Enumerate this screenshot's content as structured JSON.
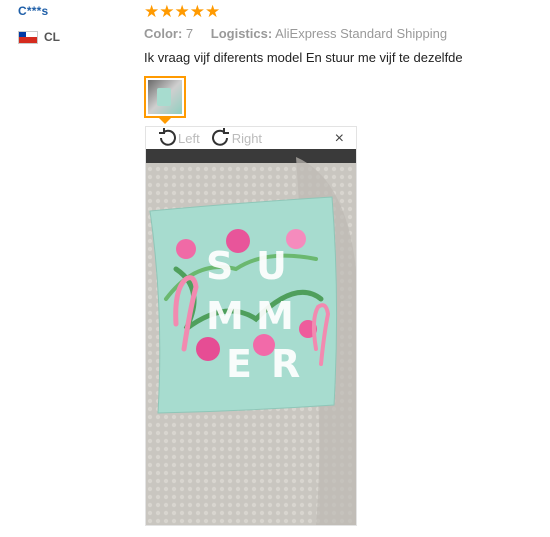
{
  "reviewer": {
    "name": "C***s",
    "country_code": "CL",
    "flag": "chile-flag"
  },
  "rating": {
    "stars": 5,
    "max": 5
  },
  "meta": {
    "color_label": "Color:",
    "color_value": "7",
    "logistics_label": "Logistics:",
    "logistics_value": "AliExpress Standard Shipping"
  },
  "review": {
    "text": "Ik vraag vijf diferents model En stuur me vijf te dezelfde"
  },
  "viewer": {
    "rotate_left": "Left",
    "rotate_right": "Right",
    "close": "×"
  },
  "photo": {
    "description_icon": "pillow-photo",
    "letters": [
      "S",
      "U",
      "M",
      "M",
      "E",
      "R"
    ]
  },
  "colors": {
    "accent": "#ff9a00",
    "link": "#1f5fa8",
    "pillow": "#a7dccf",
    "background_fabric": "#c9c6c0"
  }
}
